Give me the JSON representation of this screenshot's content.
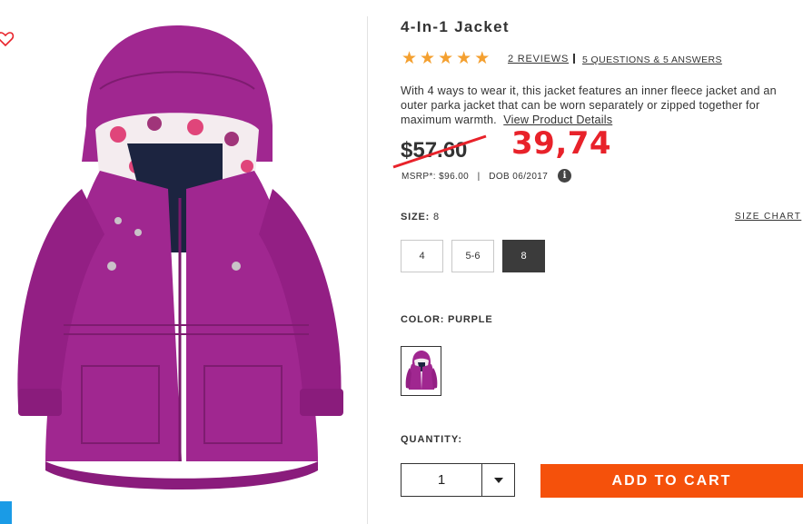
{
  "product": {
    "title": "4-In-1 Jacket",
    "rating": 5,
    "reviews_link": "2 REVIEWS",
    "qa_link": "5 QUESTIONS & 5 ANSWERS",
    "description": "With 4 ways to wear it, this jacket features an inner fleece jacket and an outer parka jacket that can be worn separately or zipped together for maximum warmth.",
    "details_link": "View Product Details",
    "old_price": "$57.60",
    "new_price": "39,74",
    "msrp": "MSRP*: $96.00",
    "dob": "DOB 06/2017",
    "info_icon_text": "i"
  },
  "size": {
    "label": "SIZE:",
    "value": "8",
    "chart_link": "SIZE CHART",
    "options": [
      "4",
      "5-6",
      "8"
    ],
    "selected": "8"
  },
  "color": {
    "label": "COLOR: PURPLE",
    "swatch_color": "#a02790"
  },
  "quantity": {
    "label": "QUANTITY:",
    "value": "1"
  },
  "add_to_cart": "ADD TO CART",
  "colors": {
    "star": "#f4a030",
    "new_price": "#e8222a",
    "cta": "#f5510b",
    "jacket": "#a02790",
    "heart": "#e8222a",
    "side_tab": "#1a9be6"
  }
}
